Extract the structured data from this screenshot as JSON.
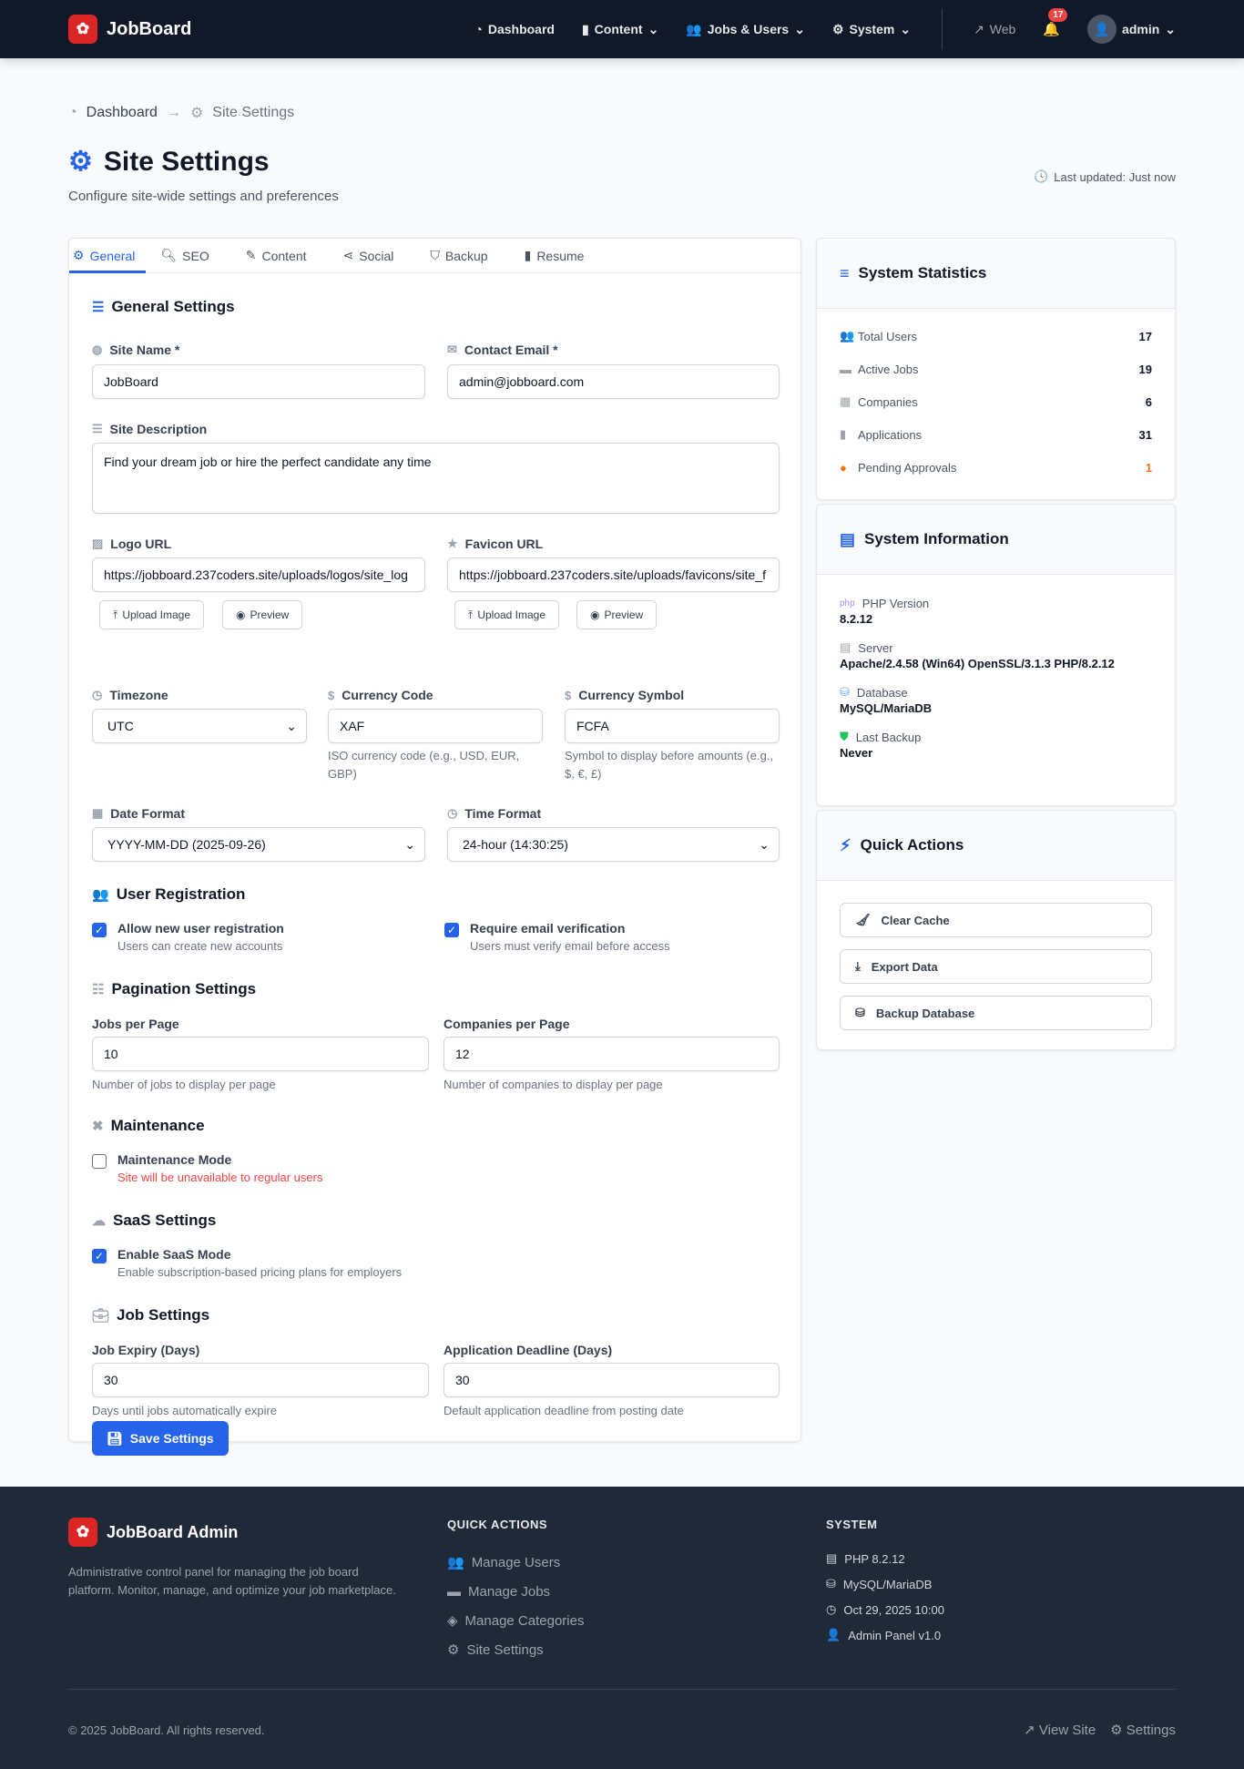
{
  "nav": {
    "brand": "JobBoard",
    "items": [
      {
        "label": "Dashboard",
        "icon": "dashboard-icon"
      },
      {
        "label": "Content",
        "icon": "file-icon",
        "dropdown": true
      },
      {
        "label": "Jobs & Users",
        "icon": "users-icon",
        "dropdown": true
      },
      {
        "label": "System",
        "icon": "gear-icon",
        "dropdown": true
      }
    ],
    "web": "Web",
    "notifications": "17",
    "user": "admin"
  },
  "breadcrumb": {
    "home": "Dashboard",
    "current": "Site Settings"
  },
  "page": {
    "title": "Site Settings",
    "subtitle": "Configure site-wide settings and preferences",
    "last_updated": "Last updated: Just now"
  },
  "tabs": [
    {
      "label": "General",
      "active": true
    },
    {
      "label": "SEO"
    },
    {
      "label": "Content"
    },
    {
      "label": "Social"
    },
    {
      "label": "Backup"
    },
    {
      "label": "Resume"
    }
  ],
  "form": {
    "heading": "General Settings",
    "site_name": {
      "label": "Site Name *",
      "value": "JobBoard"
    },
    "contact_email": {
      "label": "Contact Email *",
      "value": "admin@jobboard.com"
    },
    "site_description": {
      "label": "Site Description",
      "value": "Find your dream job or hire the perfect candidate any time"
    },
    "logo_url": {
      "label": "Logo URL",
      "value": "https://jobboard.237coders.site/uploads/logos/site_log"
    },
    "favicon_url": {
      "label": "Favicon URL",
      "value": "https://jobboard.237coders.site/uploads/favicons/site_f"
    },
    "upload_label": "Upload Image",
    "preview_label": "Preview",
    "timezone": {
      "label": "Timezone",
      "value": "UTC"
    },
    "currency_code": {
      "label": "Currency Code",
      "value": "XAF",
      "help": "ISO currency code (e.g., USD, EUR, GBP)"
    },
    "currency_symbol": {
      "label": "Currency Symbol",
      "value": "FCFA",
      "help": "Symbol to display before amounts (e.g., $, €, £)"
    },
    "date_format": {
      "label": "Date Format",
      "value": "YYYY-MM-DD (2025-09-26)"
    },
    "time_format": {
      "label": "Time Format",
      "value": "24-hour (14:30:25)"
    },
    "user_registration": {
      "heading": "User Registration",
      "allow": {
        "label": "Allow new user registration",
        "help": "Users can create new accounts",
        "checked": true
      },
      "verify": {
        "label": "Require email verification",
        "help": "Users must verify email before access",
        "checked": true
      }
    },
    "pagination": {
      "heading": "Pagination Settings",
      "jobs": {
        "label": "Jobs per Page",
        "value": "10",
        "help": "Number of jobs to display per page"
      },
      "companies": {
        "label": "Companies per Page",
        "value": "12",
        "help": "Number of companies to display per page"
      }
    },
    "maintenance": {
      "heading": "Maintenance",
      "label": "Maintenance Mode",
      "help": "Site will be unavailable to regular users",
      "checked": false
    },
    "saas": {
      "heading": "SaaS Settings",
      "label": "Enable SaaS Mode",
      "help": "Enable subscription-based pricing plans for employers",
      "checked": true
    },
    "job": {
      "heading": "Job Settings",
      "expiry": {
        "label": "Job Expiry (Days)",
        "value": "30",
        "help": "Days until jobs automatically expire"
      },
      "deadline": {
        "label": "Application Deadline (Days)",
        "value": "30",
        "help": "Default application deadline from posting date"
      }
    },
    "save_label": "Save Settings"
  },
  "stats": {
    "title": "System Statistics",
    "items": [
      {
        "label": "Total Users",
        "value": "17"
      },
      {
        "label": "Active Jobs",
        "value": "19"
      },
      {
        "label": "Companies",
        "value": "6"
      },
      {
        "label": "Applications",
        "value": "31"
      },
      {
        "label": "Pending Approvals",
        "value": "1"
      }
    ]
  },
  "sysinfo": {
    "title": "System Information",
    "items": [
      {
        "label": "PHP Version",
        "value": "8.2.12"
      },
      {
        "label": "Server",
        "value": "Apache/2.4.58 (Win64) OpenSSL/3.1.3 PHP/8.2.12"
      },
      {
        "label": "Database",
        "value": "MySQL/MariaDB"
      },
      {
        "label": "Last Backup",
        "value": "Never"
      }
    ]
  },
  "quick_actions": {
    "title": "Quick Actions",
    "items": [
      "Clear Cache",
      "Export Data",
      "Backup Database"
    ]
  },
  "footer": {
    "brand": "JobBoard Admin",
    "description": "Administrative control panel for managing the job board platform. Monitor, manage, and optimize your job marketplace.",
    "qa_title": "QUICK ACTIONS",
    "qa_links": [
      "Manage Users",
      "Manage Jobs",
      "Manage Categories",
      "Site Settings"
    ],
    "sys_title": "SYSTEM",
    "sys_items": [
      "PHP 8.2.12",
      "MySQL/MariaDB",
      "Oct 29, 2025 10:00",
      "Admin Panel v1.0"
    ],
    "copyright": "© 2025 JobBoard. All rights reserved.",
    "view_site": "View Site",
    "settings": "Settings"
  },
  "colors": {
    "accent": "#2563eb",
    "nav_bg": "#111827",
    "brand": "#dc2626",
    "warning": "#f97316",
    "danger": "#ef4444",
    "footer_bg": "#1f2937"
  }
}
